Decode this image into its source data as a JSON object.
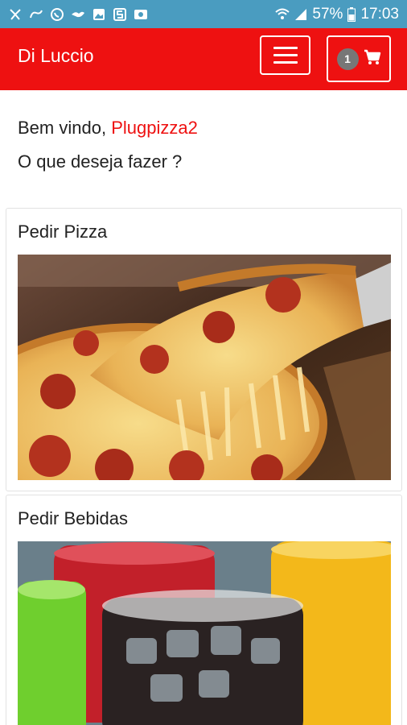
{
  "status_bar": {
    "battery": "57%",
    "time": "17:03",
    "icons": [
      "notification-icon",
      "sms-icon",
      "whatsapp-icon",
      "bird-icon",
      "image-icon",
      "s-app-icon",
      "camera-icon",
      "wifi-icon",
      "signal-icon",
      "battery-icon"
    ]
  },
  "header": {
    "brand": "Di Luccio",
    "cart_count": "1",
    "colors": {
      "primary": "#ee1111",
      "status_bar": "#4a9cc0"
    }
  },
  "welcome": {
    "greeting": "Bem vindo,",
    "username": "Plugpizza2",
    "question": "O que deseja fazer ?"
  },
  "cards": [
    {
      "title": "Pedir Pizza",
      "image": "pepperoni-pizza-photo"
    },
    {
      "title": "Pedir Bebidas",
      "image": "drinks-glasses-photo"
    }
  ]
}
